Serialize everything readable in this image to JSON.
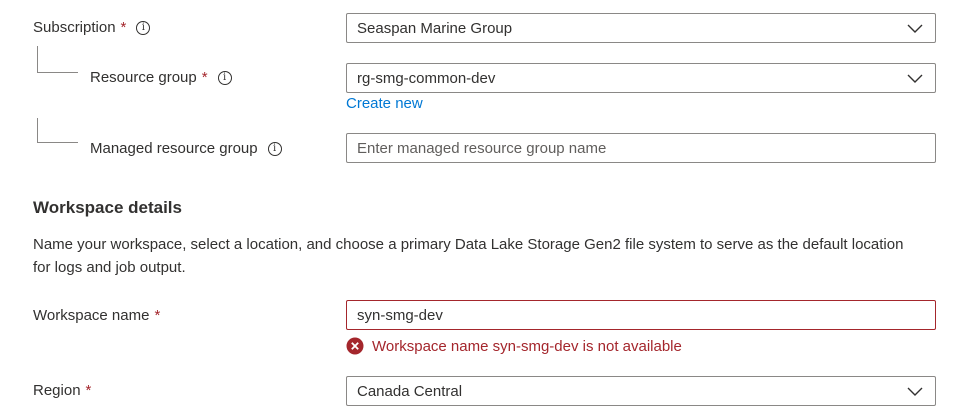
{
  "subscription": {
    "label": "Subscription",
    "required_mark": "*",
    "value": "Seaspan Marine Group"
  },
  "resource_group": {
    "label": "Resource group",
    "required_mark": "*",
    "value": "rg-smg-common-dev",
    "create_new_link": "Create new"
  },
  "managed_resource_group": {
    "label": "Managed resource group",
    "placeholder": "Enter managed resource group name",
    "value": ""
  },
  "workspace_details": {
    "title": "Workspace details",
    "description": "Name your workspace, select a location, and choose a primary Data Lake Storage Gen2 file system to serve as the default location for logs and job output."
  },
  "workspace_name": {
    "label": "Workspace name",
    "required_mark": "*",
    "value": "syn-smg-dev",
    "error_text": "Workspace name syn-smg-dev is not available"
  },
  "region": {
    "label": "Region",
    "required_mark": "*",
    "value": "Canada Central"
  },
  "icons": {
    "info": "info-icon",
    "dropdown": "chevron-down-icon",
    "error": "error-circle-icon"
  },
  "colors": {
    "required": "#a4262c",
    "error": "#a4262c",
    "link": "#0078d4",
    "border": "#8a8886",
    "text": "#323130"
  }
}
